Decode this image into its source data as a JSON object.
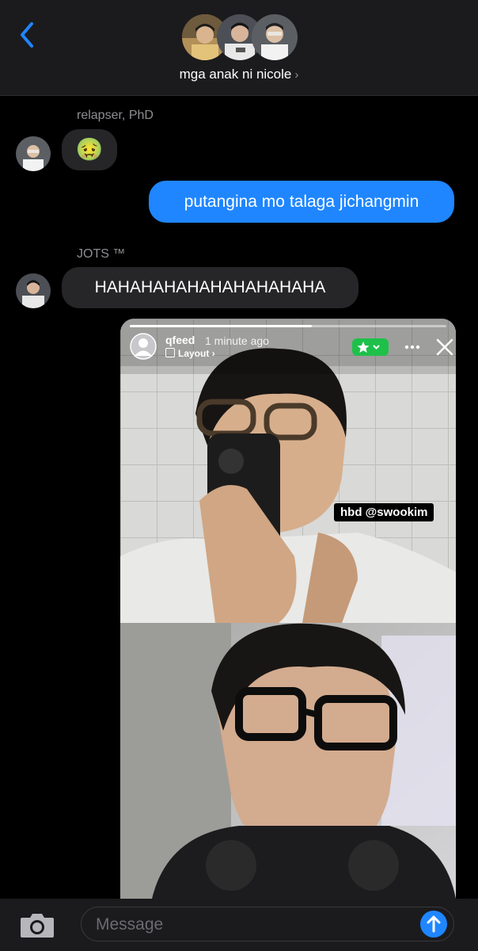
{
  "header": {
    "group_name": "mga anak ni nicole",
    "chevron": "›"
  },
  "messages": [
    {
      "sender": "relapser, PhD",
      "type": "incoming",
      "text": "🤢"
    },
    {
      "type": "outgoing",
      "text": "putangina mo talaga jichangmin"
    },
    {
      "sender": "JOTS ™",
      "type": "incoming",
      "text": "HAHAHAHAHAHAHAHAHAHA"
    }
  ],
  "story": {
    "username": "qfeed",
    "time": "1 minute ago",
    "layout_label": "Layout",
    "sticker_text": "hbd @swookim"
  },
  "composer": {
    "placeholder": "Message"
  },
  "colors": {
    "accent": "#1f86ff",
    "header_bg": "#1b1b1d",
    "incoming_bubble": "#262628",
    "close_friends_green": "#1ec04a"
  }
}
